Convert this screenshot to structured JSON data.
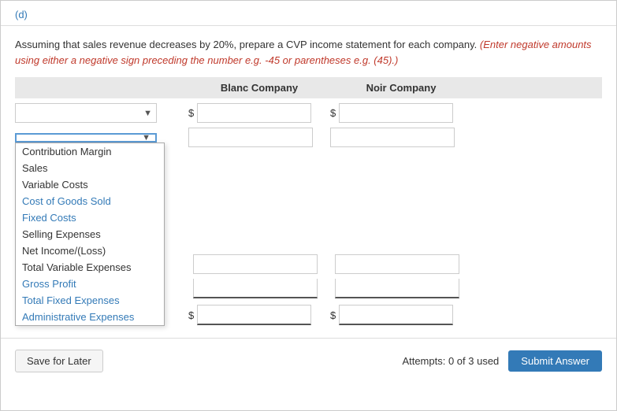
{
  "section": {
    "label": "(d)"
  },
  "instruction": {
    "text": "Assuming that sales revenue decreases by 20%, prepare a CVP income statement for each company.",
    "italic_red": "(Enter negative amounts using either a negative sign preceding the number e.g. -45 or parentheses e.g. (45).)"
  },
  "table": {
    "blanc_company": "Blanc Company",
    "noir_company": "Noir Company"
  },
  "dropdown_options": [
    "Contribution Margin",
    "Sales",
    "Variable Costs",
    "Cost of Goods Sold",
    "Fixed Costs",
    "Selling Expenses",
    "Net Income/(Loss)",
    "Total Variable Expenses",
    "Gross Profit",
    "Total Fixed Expenses",
    "Administrative Expenses"
  ],
  "footer": {
    "save_later": "Save for Later",
    "attempts": "Attempts: 0 of 3 used",
    "submit": "Submit Answer"
  }
}
